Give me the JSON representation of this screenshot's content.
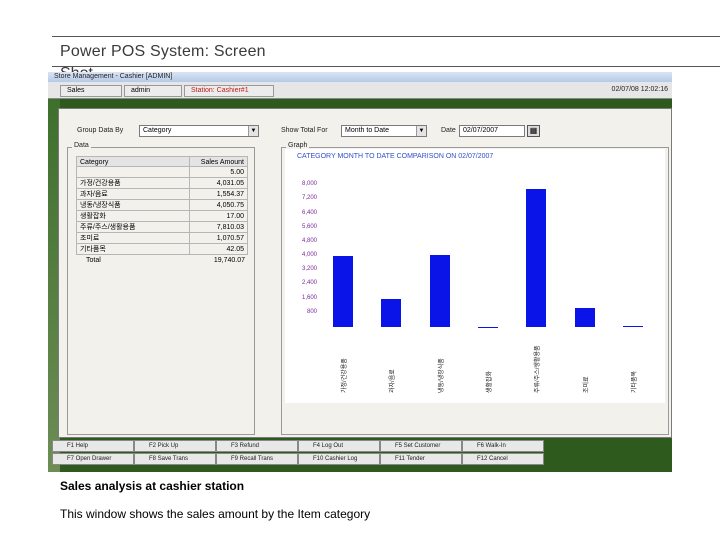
{
  "slide": {
    "title": "Power POS System: Screen",
    "title_wrap": "Shot",
    "caption_title": "Sales analysis at cashier station",
    "caption_text": "This window shows the sales amount by the Item category"
  },
  "window": {
    "title": "Store Management - Cashier [ADMIN]",
    "tabs": [
      "Sales",
      "admin",
      "Station: Cashier#1"
    ],
    "clock": "02/07/08 12:02:16"
  },
  "filters": {
    "group_label": "Group Data By",
    "group_value": "Category",
    "show_total_label": "Show Total For",
    "show_total_value": "Month to Date",
    "date_label": "Date",
    "date_value": "02/07/2007"
  },
  "data_table": {
    "group_title": "Data",
    "headers": [
      "Category",
      "Sales Amount"
    ],
    "rows": [
      {
        "category": "",
        "amount": "5.00"
      },
      {
        "category": "가정/건강용품",
        "amount": "4,031.05"
      },
      {
        "category": "과자/음료",
        "amount": "1,554.37"
      },
      {
        "category": "냉동/냉장식품",
        "amount": "4,050.75"
      },
      {
        "category": "생활잡화",
        "amount": "17.00"
      },
      {
        "category": "주류/주스/생활용품",
        "amount": "7,810.03"
      },
      {
        "category": "조미료",
        "amount": "1,070.57"
      },
      {
        "category": "기타품목",
        "amount": "42.05"
      }
    ],
    "total_label": "Total",
    "total_value": "19,740.07"
  },
  "chart_data": {
    "type": "bar",
    "group_title": "Graph",
    "title": "CATEGORY  MONTH TO DATE COMPARISON ON 02/07/2007",
    "categories": [
      "가정/건강용품",
      "과자/음료",
      "냉동/냉장식품",
      "생활잡화",
      "주류/주스/생활용품",
      "조미료",
      "기타품목"
    ],
    "values": [
      4031.05,
      1554.37,
      4050.75,
      17.0,
      7810.03,
      1070.57,
      42.05
    ],
    "y_ticks": [
      "8,000",
      "7,200",
      "6,400",
      "5,600",
      "4,800",
      "4,000",
      "3,200",
      "2,400",
      "1,600",
      "800"
    ],
    "ylim": [
      0,
      8800
    ],
    "bar_color": "#0a14e8",
    "grid": false
  },
  "fkeys": [
    "F1 Help",
    "F2 Pick Up",
    "F3 Refund",
    "F4 Log Out",
    "F5 Set Customer",
    "F6 Walk-In",
    "F7 Open Drawer",
    "F8 Save Trans",
    "F9 Recall Trans",
    "F10 Cashier Log",
    "F11 Tender",
    "F12 Cancel"
  ]
}
